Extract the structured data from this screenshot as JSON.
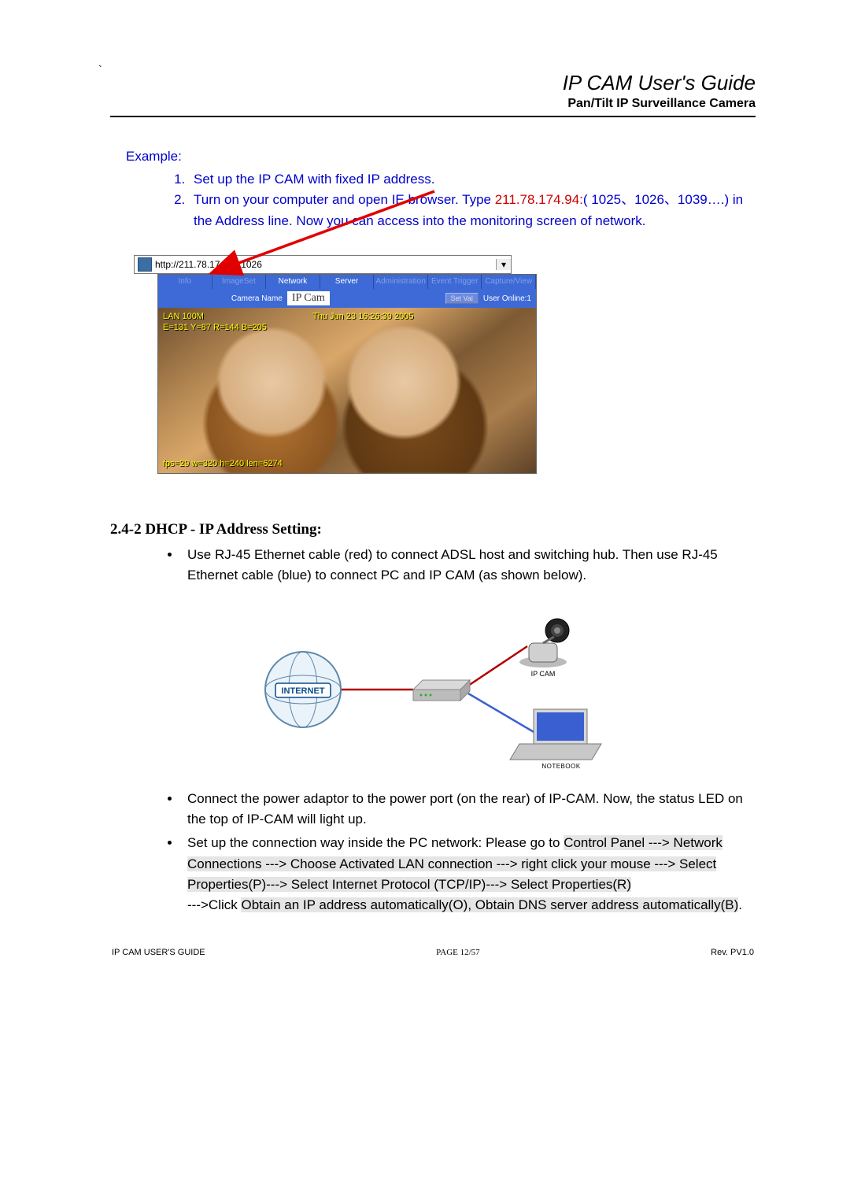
{
  "header": {
    "title": "IP CAM User's Guide",
    "subtitle": "Pan/Tilt IP Surveillance Camera"
  },
  "example": {
    "label": "Example:",
    "item1": "Set up the IP CAM with fixed IP address.",
    "item2_pre": "Turn on your computer and open IE browser. Type ",
    "item2_red": "211.78.174.94:",
    "item2_post": "( 1025、1026、1039….) in the Address line. Now you can access into the monitoring screen of network."
  },
  "addressbar": {
    "url": "http://211.78.174.94:1026"
  },
  "cam_tabs": [
    "Info",
    "ImageSet",
    "Network",
    "Server",
    "Administration",
    "Event Trigger",
    "Capture/View"
  ],
  "cam_row2": {
    "label": "Camera Name",
    "value": "IP Cam",
    "btn": "Set Val",
    "users": "User Online:1"
  },
  "cam_overlay": {
    "line1": "LAN 100M",
    "line1r": "Thu Jun 23 16:26:39 2005",
    "line2": "E=131 Y=87 R=144 B=205",
    "bottom": "fps=29 w=320 h=240 len=6274"
  },
  "section_heading": "2.4-2 DHCP - IP Address Setting:",
  "bullets": {
    "b1": "Use RJ-45 Ethernet cable (red) to connect ADSL host and switching hub. Then use RJ-45 Ethernet cable (blue) to connect PC and IP CAM (as shown below).",
    "b2": "Connect the power adaptor to the power port (on the rear) of IP-CAM. Now, the status LED on the top of IP-CAM will light up.",
    "b3_pre": "Set up the connection way inside the PC network: Please go to",
    "b3_hl1": "Control Panel ---> Network Connections ---> Choose   Activated LAN connection ---> right click your mouse ---> Select Properties(P)---> Select Internet Protocol (TCP/IP)---> Select Properties(R)",
    "b3_mid": "--->Click ",
    "b3_hl2": "Obtain an IP address automatically(O), Obtain DNS server address automatically(B)",
    "b3_end": "."
  },
  "diagram_labels": {
    "internet": "INTERNET",
    "ipcam": "IP CAM",
    "notebook": "NOTEBOOK"
  },
  "footer": {
    "left": "IP CAM USER'S GUIDE",
    "center_prefix": "PAGE ",
    "center_page": "12/57",
    "right": "Rev. PV1.0"
  }
}
